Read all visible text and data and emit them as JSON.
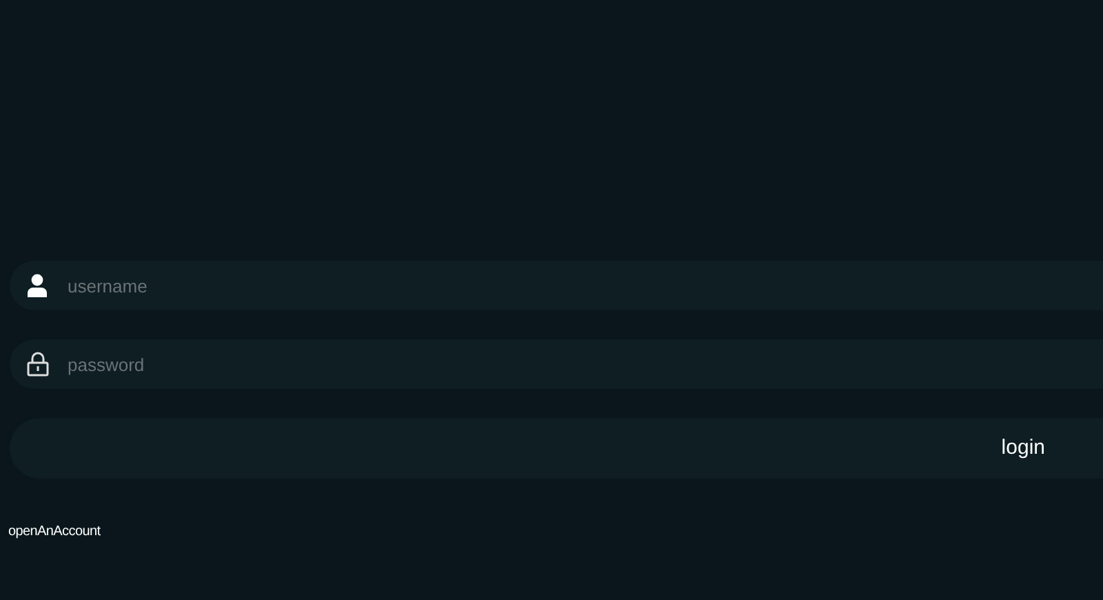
{
  "fields": [
    {
      "kind": "user",
      "placeholder": "username"
    },
    {
      "kind": "lock",
      "placeholder": "password"
    }
  ],
  "login_button": "login",
  "open_account_link": "openAnAccount"
}
